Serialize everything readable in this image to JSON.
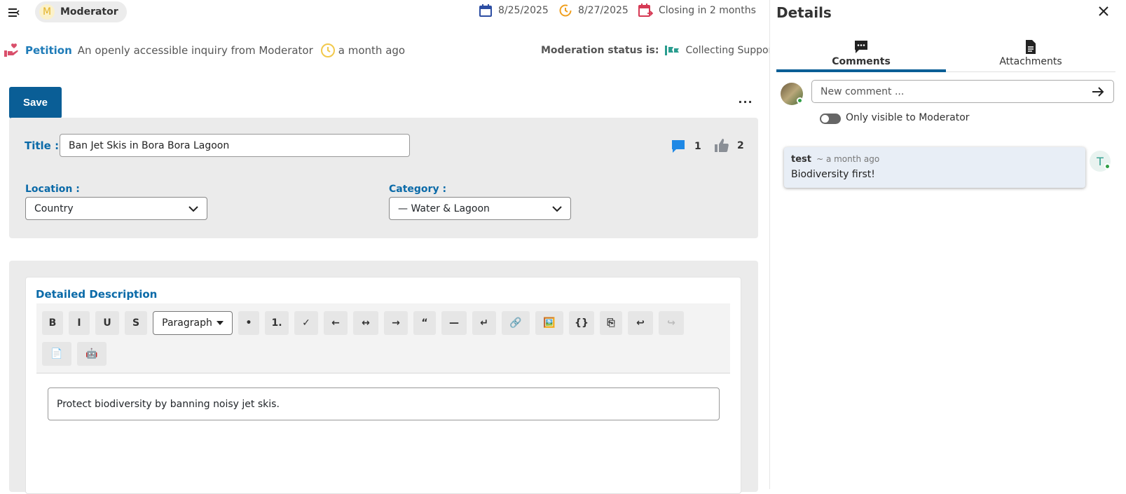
{
  "header": {
    "role_initial": "M",
    "role_name": "Moderator",
    "start_date": "8/25/2025",
    "end_date": "8/27/2025",
    "closing": "Closing in 2 months"
  },
  "petition": {
    "type": "Petition",
    "description": "An openly accessible inquiry from Moderator",
    "time": "a month ago",
    "moderation_label": "Moderation status is:",
    "moderation_value": "Collecting Support"
  },
  "actions": {
    "save_label": "Save",
    "more_label": "···"
  },
  "form": {
    "title_label": "Title :",
    "title_value": "Ban Jet Skis in Bora Bora Lagoon",
    "comment_count": "1",
    "like_count": "2",
    "location_label": "Location :",
    "location_value": "Country",
    "category_label": "Category :",
    "category_value": "— Water & Lagoon"
  },
  "editor": {
    "label": "Detailed Description",
    "paragraph_option": "Paragraph",
    "content": "Protect biodiversity by banning noisy jet skis.",
    "toolbar": {
      "bold": "B",
      "italic": "I",
      "underline": "U",
      "strike": "S",
      "bullet": "•",
      "ordered": "1.",
      "check": "✓",
      "outdent": "←",
      "center": "↔",
      "indent": "→",
      "quote": "“",
      "hr": "—",
      "break": "↵",
      "link": "🔗",
      "image": "🖼️",
      "code": "{}",
      "copy": "⎘",
      "undo": "↩",
      "redo": "↪",
      "doc": "📄",
      "ai": "🤖"
    }
  },
  "details": {
    "title": "Details",
    "tabs": [
      {
        "label": "Comments"
      },
      {
        "label": "Attachments"
      }
    ],
    "comment_placeholder": "New comment ...",
    "visibility_label": "Only visible to Moderator",
    "comments": [
      {
        "author": "test",
        "time": "~ a month ago",
        "text": "Biodiversity first!",
        "avatar_initial": "T"
      }
    ]
  },
  "colors": {
    "primary": "#0a5e96",
    "accent_label": "#0a6aa8",
    "calendar_start": "#2d4ea3",
    "calendar_end": "#d63a55",
    "clock": "#f0a020",
    "online": "#2f9e44"
  }
}
